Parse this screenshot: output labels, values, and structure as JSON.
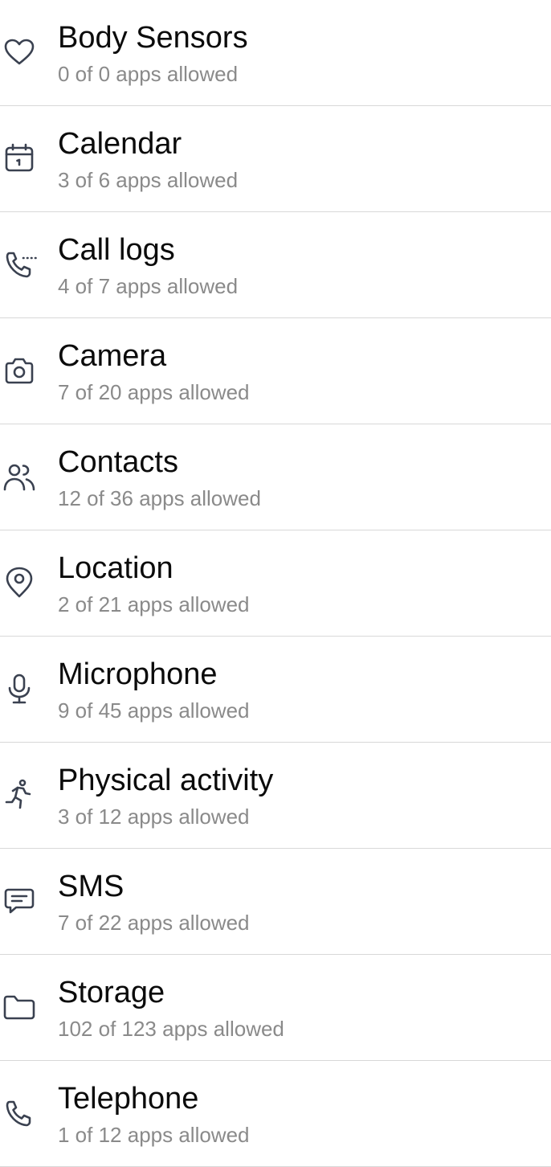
{
  "permissions": [
    {
      "icon": "heart-icon",
      "title": "Body Sensors",
      "subtitle": "0 of 0 apps allowed"
    },
    {
      "icon": "calendar-icon",
      "title": "Calendar",
      "subtitle": "3 of 6 apps allowed"
    },
    {
      "icon": "call-log-icon",
      "title": "Call logs",
      "subtitle": "4 of 7 apps allowed"
    },
    {
      "icon": "camera-icon",
      "title": "Camera",
      "subtitle": "7 of 20 apps allowed"
    },
    {
      "icon": "contacts-icon",
      "title": "Contacts",
      "subtitle": "12 of 36 apps allowed"
    },
    {
      "icon": "location-pin-icon",
      "title": "Location",
      "subtitle": "2 of 21 apps allowed"
    },
    {
      "icon": "microphone-icon",
      "title": "Microphone",
      "subtitle": "9 of 45 apps allowed"
    },
    {
      "icon": "running-person-icon",
      "title": "Physical activity",
      "subtitle": "3 of 12 apps allowed"
    },
    {
      "icon": "chat-bubble-icon",
      "title": "SMS",
      "subtitle": "7 of 22 apps allowed"
    },
    {
      "icon": "folder-icon",
      "title": "Storage",
      "subtitle": "102 of 123 apps allowed"
    },
    {
      "icon": "phone-icon",
      "title": "Telephone",
      "subtitle": "1 of 12 apps allowed"
    }
  ],
  "colors": {
    "title": "#0b0b0b",
    "subtitle": "#8a8a8a",
    "icon": "#3a4150",
    "divider": "#d8d8d8"
  }
}
